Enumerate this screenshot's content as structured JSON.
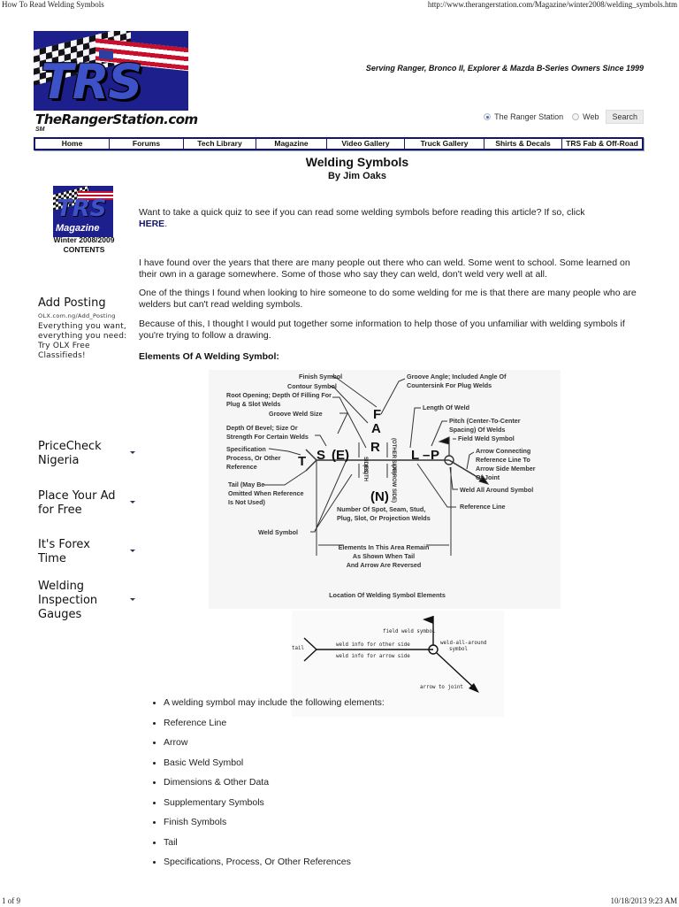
{
  "print_header": {
    "title": "How To Read Welding Symbols",
    "url": "http://www.therangerstation.com/Magazine/winter2008/welding_symbols.htm"
  },
  "print_footer": {
    "page": "1 of 9",
    "timestamp": "10/18/2013 9:23 AM"
  },
  "header": {
    "logo_text": "TRS",
    "site_name": "TheRangerStation.com",
    "service_mark": "SM",
    "tagline": "Serving Ranger, Bronco II, Explorer & Mazda B-Series Owners Since 1999",
    "search": {
      "options": [
        {
          "label": "The Ranger Station",
          "selected": true
        },
        {
          "label": "Web",
          "selected": false
        }
      ],
      "button_label": "Search"
    }
  },
  "nav": {
    "items": [
      {
        "label": "Home"
      },
      {
        "label": "Forums"
      },
      {
        "label": "Tech Library"
      },
      {
        "label": "Magazine"
      },
      {
        "label": "Video Gallery"
      },
      {
        "label": "Truck Gallery"
      },
      {
        "label": "Shirts & Decals"
      },
      {
        "label": "TRS Fab & Off-Road"
      }
    ]
  },
  "article": {
    "title": "Welding Symbols",
    "byline": "By Jim Oaks",
    "quiz_text": "Want to take a quick quiz to see if you can read some welding symbols before reading this article? If so, click",
    "quiz_link": "HERE",
    "quiz_end": ".",
    "paragraphs": [
      "I have found over the years that there are many people out there who can weld. Some went to school. Some learned on their own in a garage somewhere. Some of those who say they can weld, don't weld very well at all.",
      "One of the things I found when looking to hire someone to do some welding for me is that there are many people who are welders but can't read welding symbols.",
      "Because of this, I thought I would put together some information to help those of you unfamiliar with welding symbols if you're trying to follow a drawing."
    ],
    "section_heading": "Elements Of A Welding Symbol:",
    "bullets": [
      "A welding symbol may include the following elements:",
      "Reference Line",
      "Arrow",
      "Basic Weld Symbol",
      "Dimensions & Other Data",
      "Supplementary Symbols",
      "Finish Symbols",
      "Tail",
      "Specifications, Process, Or Other References"
    ]
  },
  "sidebar": {
    "magazine_logo_text": "TRS",
    "magazine_label": "Magazine",
    "issue": "Winter 2008/2009",
    "contents": "CONTENTS",
    "ad": {
      "title": "Add Posting",
      "url": "OLX.com.ng/Add_Posting",
      "description": "Everything you want, everything you need: Try OLX Free Classifieds!"
    },
    "ad_links": [
      {
        "label": "PriceCheck Nigeria"
      },
      {
        "label": "Place Your Ad for Free"
      },
      {
        "label": "It's Forex Time"
      },
      {
        "label": "Welding Inspection Gauges"
      }
    ]
  },
  "diagram1": {
    "caption": "Location Of Welding Symbol Elements",
    "letters": {
      "F": "F",
      "A": "A",
      "R": "R",
      "T": "T",
      "S": "S",
      "E": "(E)",
      "L": "L",
      "dash": "–",
      "P": "P",
      "N": "(N)"
    },
    "side_labels": {
      "sides": "SIDES)",
      "both": "(BOTH",
      "other": "(OTHER SIDE)",
      "arrow": "(ARROW SIDE)"
    },
    "labels": {
      "finish_symbol": "Finish Symbol",
      "contour_symbol": "Contour Symbol",
      "root_opening_1": "Root Opening; Depth Of Filling For",
      "root_opening_2": "Plug & Slot Welds",
      "groove_weld_size": "Groove Weld Size",
      "depth_bevel_1": "Depth Of Bevel; Size Or",
      "depth_bevel_2": "Strength For Certain Welds",
      "spec_1": "Specification",
      "spec_2": "Process, Or Other",
      "spec_3": "Reference",
      "tail_1": "Tail (May Be",
      "tail_2": "Omitted When Reference",
      "tail_3": "Is Not Used)",
      "weld_symbol": "Weld Symbol",
      "groove_angle_1": "Groove Angle; Included Angle Of",
      "groove_angle_2": "Countersink For Plug Welds",
      "length_of_weld": "Length Of Weld",
      "pitch_1": "Pitch (Center-To-Center",
      "pitch_2": "Spacing) Of Welds",
      "field_weld": "Field Weld Symbol",
      "arrow_conn_1": "Arrow Connecting",
      "arrow_conn_2": "Reference Line To",
      "arrow_conn_3": "Arrow Side Member",
      "arrow_conn_4": "Of Joint",
      "weld_all_around": "Weld All Around Symbol",
      "reference_line": "Reference Line",
      "number_of_1": "Number Of Spot, Seam, Stud,",
      "number_of_2": "Plug, Slot, Or Projection Welds",
      "elements_1": "Elements In This Area Remain",
      "elements_2": "As Shown When Tail",
      "elements_3": "And Arrow Are Reversed"
    }
  },
  "diagram2": {
    "field_weld_symbol": "field weld symbol",
    "weld_all_around_1": "weld-all-around",
    "weld_all_around_2": "symbol",
    "tail": "tail",
    "other_side": "weld info for other side",
    "arrow_side": "weld info for arrow side",
    "arrow_to_joint": "arrow to joint"
  }
}
